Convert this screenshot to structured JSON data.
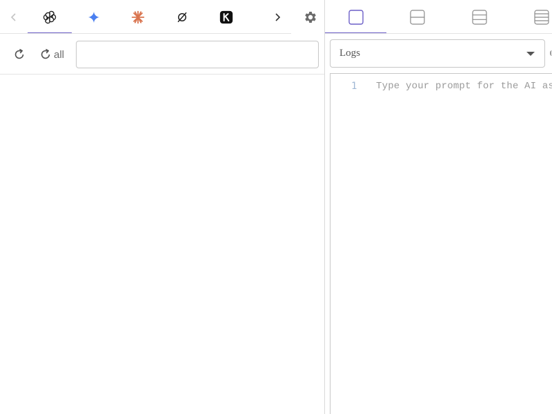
{
  "left_panel": {
    "tabs": [
      {
        "id": "chatgpt",
        "icon": "openai-icon",
        "active": true
      },
      {
        "id": "gemini",
        "icon": "gemini-sparkle-icon",
        "color": "#4a7ff0",
        "active": false
      },
      {
        "id": "claude",
        "icon": "claude-asterisk-icon",
        "color": "#d9744f",
        "active": false
      },
      {
        "id": "perplexity",
        "icon": "slashed-circle-icon",
        "active": false
      },
      {
        "id": "kimi",
        "icon": "k-logo-icon",
        "active": false
      }
    ],
    "nav": {
      "prev_icon": "chevron-left-icon",
      "next_icon": "chevron-right-icon",
      "prev_disabled": true
    },
    "settings_icon": "gear-icon",
    "toolbar": {
      "reload_icon": "reload-icon",
      "reload_all_label": "all",
      "url_value": "",
      "url_placeholder": ""
    }
  },
  "right_panel": {
    "layout_tabs": [
      {
        "id": "layout-1",
        "icon": "single-pane-icon",
        "active": true
      },
      {
        "id": "layout-2",
        "icon": "two-row-icon",
        "active": false
      },
      {
        "id": "layout-3",
        "icon": "three-row-icon",
        "active": false
      },
      {
        "id": "layout-4",
        "icon": "four-row-icon",
        "active": false
      }
    ],
    "select": {
      "label": "Logs"
    },
    "editor": {
      "line_number": "1",
      "placeholder": "Type your prompt for the AI assi"
    }
  },
  "colors": {
    "accent": "#6c5fc7",
    "border": "#c7c7c7",
    "gutter_number": "#9fb7d4",
    "placeholder": "#9a9a9a"
  }
}
